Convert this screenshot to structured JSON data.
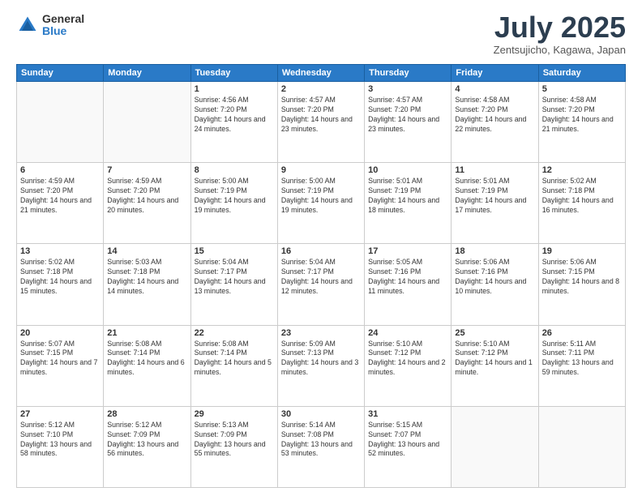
{
  "header": {
    "logo_general": "General",
    "logo_blue": "Blue",
    "month_title": "July 2025",
    "location": "Zentsujicho, Kagawa, Japan"
  },
  "days_of_week": [
    "Sunday",
    "Monday",
    "Tuesday",
    "Wednesday",
    "Thursday",
    "Friday",
    "Saturday"
  ],
  "weeks": [
    [
      {
        "day": "",
        "info": ""
      },
      {
        "day": "",
        "info": ""
      },
      {
        "day": "1",
        "info": "Sunrise: 4:56 AM\nSunset: 7:20 PM\nDaylight: 14 hours and 24 minutes."
      },
      {
        "day": "2",
        "info": "Sunrise: 4:57 AM\nSunset: 7:20 PM\nDaylight: 14 hours and 23 minutes."
      },
      {
        "day": "3",
        "info": "Sunrise: 4:57 AM\nSunset: 7:20 PM\nDaylight: 14 hours and 23 minutes."
      },
      {
        "day": "4",
        "info": "Sunrise: 4:58 AM\nSunset: 7:20 PM\nDaylight: 14 hours and 22 minutes."
      },
      {
        "day": "5",
        "info": "Sunrise: 4:58 AM\nSunset: 7:20 PM\nDaylight: 14 hours and 21 minutes."
      }
    ],
    [
      {
        "day": "6",
        "info": "Sunrise: 4:59 AM\nSunset: 7:20 PM\nDaylight: 14 hours and 21 minutes."
      },
      {
        "day": "7",
        "info": "Sunrise: 4:59 AM\nSunset: 7:20 PM\nDaylight: 14 hours and 20 minutes."
      },
      {
        "day": "8",
        "info": "Sunrise: 5:00 AM\nSunset: 7:19 PM\nDaylight: 14 hours and 19 minutes."
      },
      {
        "day": "9",
        "info": "Sunrise: 5:00 AM\nSunset: 7:19 PM\nDaylight: 14 hours and 19 minutes."
      },
      {
        "day": "10",
        "info": "Sunrise: 5:01 AM\nSunset: 7:19 PM\nDaylight: 14 hours and 18 minutes."
      },
      {
        "day": "11",
        "info": "Sunrise: 5:01 AM\nSunset: 7:19 PM\nDaylight: 14 hours and 17 minutes."
      },
      {
        "day": "12",
        "info": "Sunrise: 5:02 AM\nSunset: 7:18 PM\nDaylight: 14 hours and 16 minutes."
      }
    ],
    [
      {
        "day": "13",
        "info": "Sunrise: 5:02 AM\nSunset: 7:18 PM\nDaylight: 14 hours and 15 minutes."
      },
      {
        "day": "14",
        "info": "Sunrise: 5:03 AM\nSunset: 7:18 PM\nDaylight: 14 hours and 14 minutes."
      },
      {
        "day": "15",
        "info": "Sunrise: 5:04 AM\nSunset: 7:17 PM\nDaylight: 14 hours and 13 minutes."
      },
      {
        "day": "16",
        "info": "Sunrise: 5:04 AM\nSunset: 7:17 PM\nDaylight: 14 hours and 12 minutes."
      },
      {
        "day": "17",
        "info": "Sunrise: 5:05 AM\nSunset: 7:16 PM\nDaylight: 14 hours and 11 minutes."
      },
      {
        "day": "18",
        "info": "Sunrise: 5:06 AM\nSunset: 7:16 PM\nDaylight: 14 hours and 10 minutes."
      },
      {
        "day": "19",
        "info": "Sunrise: 5:06 AM\nSunset: 7:15 PM\nDaylight: 14 hours and 8 minutes."
      }
    ],
    [
      {
        "day": "20",
        "info": "Sunrise: 5:07 AM\nSunset: 7:15 PM\nDaylight: 14 hours and 7 minutes."
      },
      {
        "day": "21",
        "info": "Sunrise: 5:08 AM\nSunset: 7:14 PM\nDaylight: 14 hours and 6 minutes."
      },
      {
        "day": "22",
        "info": "Sunrise: 5:08 AM\nSunset: 7:14 PM\nDaylight: 14 hours and 5 minutes."
      },
      {
        "day": "23",
        "info": "Sunrise: 5:09 AM\nSunset: 7:13 PM\nDaylight: 14 hours and 3 minutes."
      },
      {
        "day": "24",
        "info": "Sunrise: 5:10 AM\nSunset: 7:12 PM\nDaylight: 14 hours and 2 minutes."
      },
      {
        "day": "25",
        "info": "Sunrise: 5:10 AM\nSunset: 7:12 PM\nDaylight: 14 hours and 1 minute."
      },
      {
        "day": "26",
        "info": "Sunrise: 5:11 AM\nSunset: 7:11 PM\nDaylight: 13 hours and 59 minutes."
      }
    ],
    [
      {
        "day": "27",
        "info": "Sunrise: 5:12 AM\nSunset: 7:10 PM\nDaylight: 13 hours and 58 minutes."
      },
      {
        "day": "28",
        "info": "Sunrise: 5:12 AM\nSunset: 7:09 PM\nDaylight: 13 hours and 56 minutes."
      },
      {
        "day": "29",
        "info": "Sunrise: 5:13 AM\nSunset: 7:09 PM\nDaylight: 13 hours and 55 minutes."
      },
      {
        "day": "30",
        "info": "Sunrise: 5:14 AM\nSunset: 7:08 PM\nDaylight: 13 hours and 53 minutes."
      },
      {
        "day": "31",
        "info": "Sunrise: 5:15 AM\nSunset: 7:07 PM\nDaylight: 13 hours and 52 minutes."
      },
      {
        "day": "",
        "info": ""
      },
      {
        "day": "",
        "info": ""
      }
    ]
  ]
}
